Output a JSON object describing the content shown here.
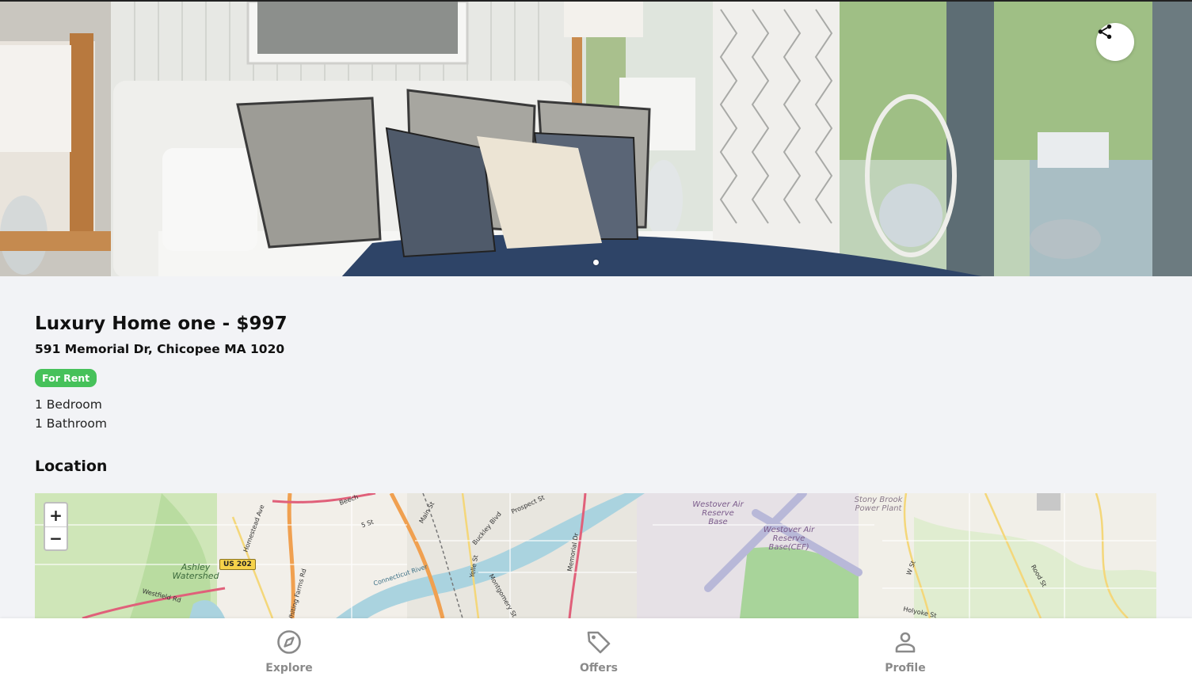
{
  "listing": {
    "title": "Luxury Home one - $997",
    "address": "591 Memorial Dr, Chicopee MA 1020",
    "status_badge": "For Rent",
    "bedrooms": "1 Bedroom",
    "bathrooms": "1 Bathroom"
  },
  "gallery": {
    "dot_count": 1,
    "active_index": 0,
    "share_icon": "share-icon"
  },
  "location": {
    "section_title": "Location",
    "zoom_in": "+",
    "zoom_out": "−",
    "labels": {
      "westover_base": "Westover Air Reserve Base",
      "westover_cef": "Westover Air Reserve Base(CEF)",
      "stony_brook": "Stony Brook Power Plant",
      "ashley": "Ashley Watershed",
      "route": "US 202",
      "river": "Connecticut River"
    },
    "roads": [
      "Westfield Rd",
      "Homestead Ave",
      "Main St",
      "Buckley Blvd",
      "Prospect St",
      "Memorial Dr",
      "Yelle St",
      "Montgomery St",
      "Whiting Farms Rd",
      "W St",
      "Rood St",
      "Holyoke St",
      "5 St",
      "Beech"
    ]
  },
  "colors": {
    "badge": "#46c15a",
    "nav_text": "#8a8a8a",
    "background": "#f2f3f6"
  },
  "bottom_nav": {
    "items": [
      {
        "label": "Explore",
        "icon": "compass-icon"
      },
      {
        "label": "Offers",
        "icon": "tag-icon"
      },
      {
        "label": "Profile",
        "icon": "person-icon"
      }
    ]
  }
}
